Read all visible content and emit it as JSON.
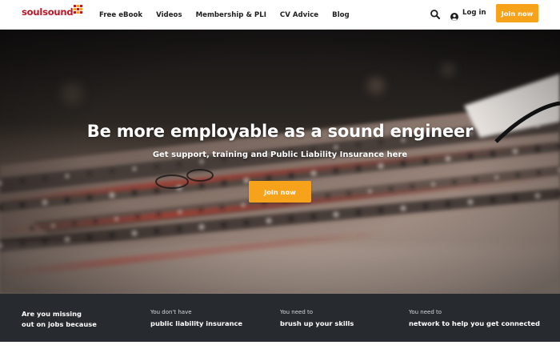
{
  "brand": {
    "name": "soulsound",
    "mark_colors": [
      "#b31b29",
      "#f7a21b",
      "#b31b29",
      "#f7a21b",
      "#b31b29",
      "#f7a21b",
      "#b31b29",
      "#f7a21b",
      "#b31b29"
    ]
  },
  "nav": {
    "items": [
      {
        "label": "Free eBook"
      },
      {
        "label": "Videos"
      },
      {
        "label": "Membership & PLI"
      },
      {
        "label": "CV Advice"
      },
      {
        "label": "Blog"
      }
    ]
  },
  "header": {
    "search_icon": "search-icon",
    "login_icon": "user-circle-icon",
    "login_label": "Log in",
    "join_label": "Join now"
  },
  "hero": {
    "title": "Be more employable as a sound engineer",
    "subtitle": "Get support, training and Public Liability Insurance here",
    "cta_label": "Join now"
  },
  "strip": {
    "intro_line1": "Are you missing",
    "intro_line2": "out on jobs because",
    "items": [
      {
        "small": "You don't have",
        "strong": "public liability insurance"
      },
      {
        "small": "You need to",
        "strong": "brush up your skills"
      },
      {
        "small": "You need to",
        "strong": "network to help you get connected"
      }
    ]
  },
  "colors": {
    "accent": "#f7a21b",
    "brand_red": "#b31b29",
    "strip_bg": "#272b30"
  }
}
